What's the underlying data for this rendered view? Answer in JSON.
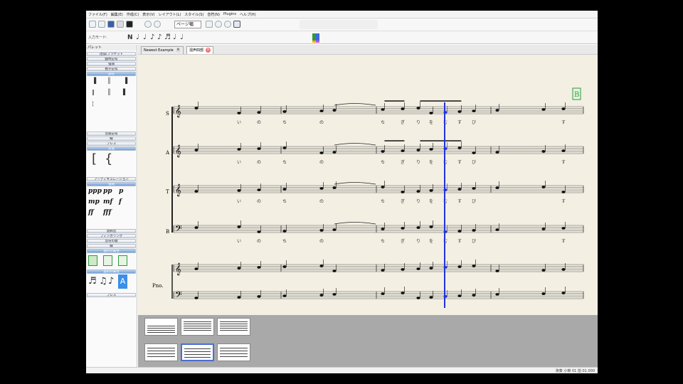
{
  "menu": [
    "ファイル(F)",
    "編集(E)",
    "作成(C)",
    "表示(V)",
    "レイアウト(L)",
    "スタイル(S)",
    "音符(N)",
    "Plugins",
    "ヘルプ(H)"
  ],
  "toolbar": {
    "zoom_value": "ページ幅",
    "input_mode_label": "入力モード:",
    "note_values": [
      "♩",
      "♩",
      "♪",
      "♪",
      "♬",
      "♩",
      "♩"
    ],
    "accent": "#f2b400"
  },
  "tabs": [
    {
      "label": "Newest Example",
      "active": false
    },
    {
      "label": "混声四部",
      "active": true
    }
  ],
  "palette": {
    "title": "パレット",
    "sections": [
      "括弧/ブラケット",
      "臨時記号",
      "強弱",
      "拍子記号",
      "調号",
      "音部記号",
      "線",
      "アーティキュレーション",
      "装飾音",
      "反復",
      "ブレス",
      "フィンガリング",
      "音符の頭",
      "連桁の属性"
    ],
    "dynamics": [
      "ppp",
      "pp",
      "p",
      "mp",
      "mf",
      "f",
      "ff",
      "fff"
    ]
  },
  "score": {
    "rehearsal_mark": "B",
    "parts": [
      "S",
      "A",
      "T",
      "B"
    ],
    "piano_label": "Pno.",
    "lyrics": [
      "い",
      "の",
      "ち",
      "の",
      "ち",
      "ぎ",
      "り",
      "を",
      "む",
      "す",
      "び",
      "",
      "す"
    ]
  },
  "status": {
    "text": "演奏 小節 01 拍 01.000"
  }
}
